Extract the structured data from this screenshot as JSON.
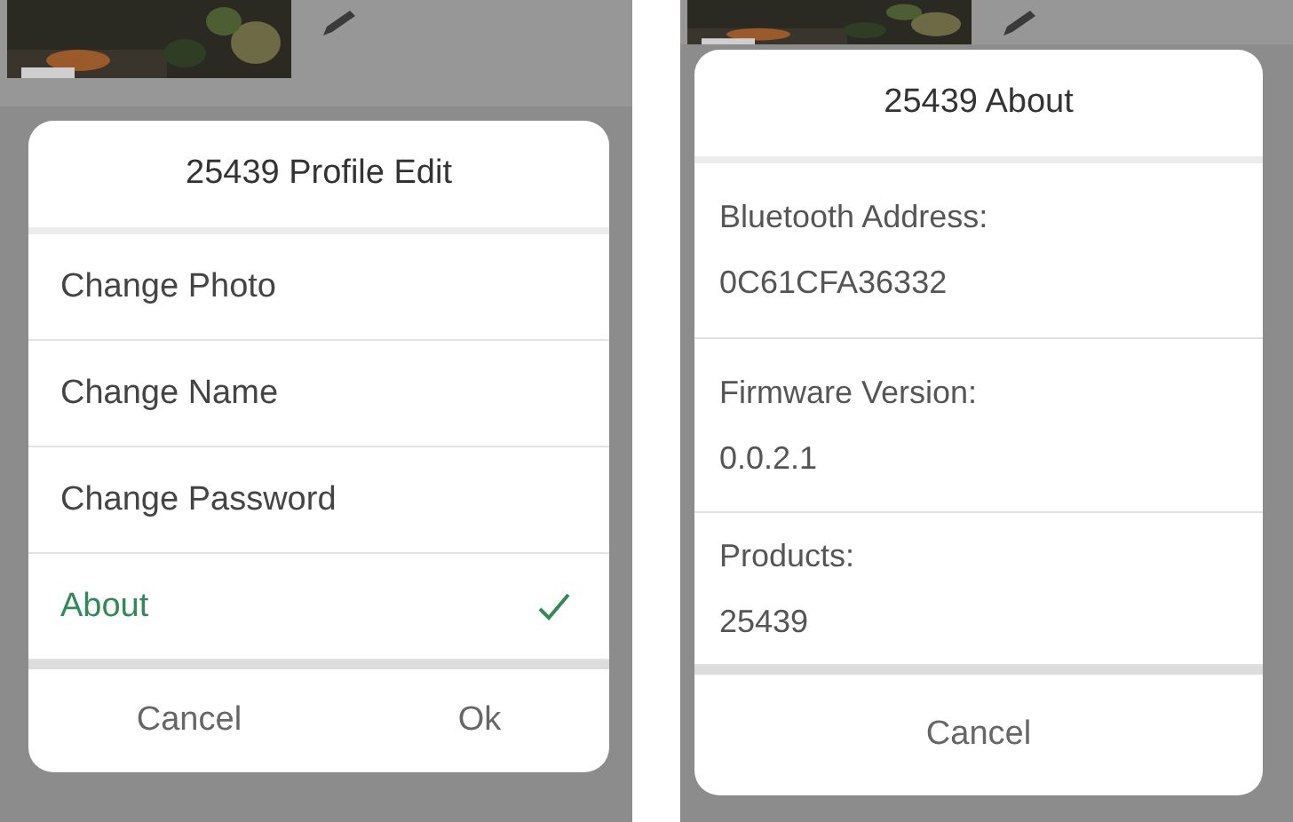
{
  "screens": [
    {
      "kind": "menu",
      "title": "25439 Profile Edit",
      "items": [
        {
          "label": "Change Photo",
          "selected": false
        },
        {
          "label": "Change Name",
          "selected": false
        },
        {
          "label": "Change Password",
          "selected": false
        },
        {
          "label": "About",
          "selected": true
        }
      ],
      "buttons": [
        "Cancel",
        "Ok"
      ]
    },
    {
      "kind": "info",
      "title": "25439 About",
      "fields": [
        {
          "label": "Bluetooth Address:",
          "value": "0C61CFA36332"
        },
        {
          "label": "Firmware Version:",
          "value": "0.0.2.1"
        },
        {
          "label": "Products:",
          "value": "25439"
        }
      ],
      "buttons": [
        "Cancel"
      ]
    }
  ]
}
